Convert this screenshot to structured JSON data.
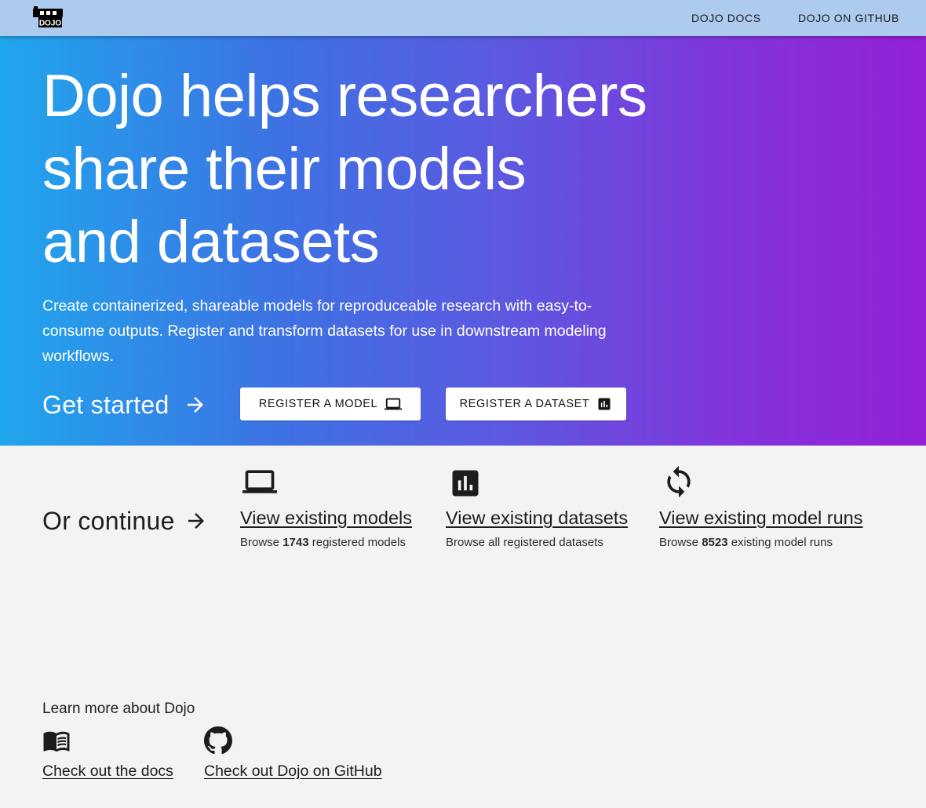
{
  "nav": {
    "logo_text": "DOJO",
    "links": [
      {
        "label": "DOJO DOCS"
      },
      {
        "label": "DOJO ON GITHUB"
      }
    ]
  },
  "hero": {
    "title_lines": [
      "Dojo helps researchers",
      "share their models",
      "and datasets"
    ],
    "description": "Create containerized, shareable models for reproduceable research with easy-to-consume outputs. Register and transform datasets for use in downstream modeling workflows.",
    "get_started": "Get started",
    "buttons": {
      "register_model": "REGISTER A MODEL",
      "register_dataset": "REGISTER A DATASET"
    }
  },
  "continue": {
    "label": "Or continue",
    "cards": [
      {
        "icon": "laptop-icon",
        "link": "View existing models",
        "sub_prefix": "Browse ",
        "count": "1743",
        "sub_suffix": " registered models"
      },
      {
        "icon": "bar-chart-icon",
        "link": "View existing datasets",
        "sub_text": "Browse all registered datasets"
      },
      {
        "icon": "sync-icon",
        "link": "View existing model runs",
        "sub_prefix": "Browse ",
        "count": "8523",
        "sub_suffix": " existing model runs"
      }
    ]
  },
  "learn_more": {
    "heading": "Learn more about Dojo",
    "items": [
      {
        "icon": "book-icon",
        "link": "Check out the docs"
      },
      {
        "icon": "github-icon",
        "link": "Check out Dojo on GitHub"
      }
    ]
  },
  "colors": {
    "nav_bg": "#adcbef",
    "hero_gradient_start": "#20a6ec",
    "hero_gradient_end": "#9420d7",
    "page_bg": "#f3f3f3"
  }
}
